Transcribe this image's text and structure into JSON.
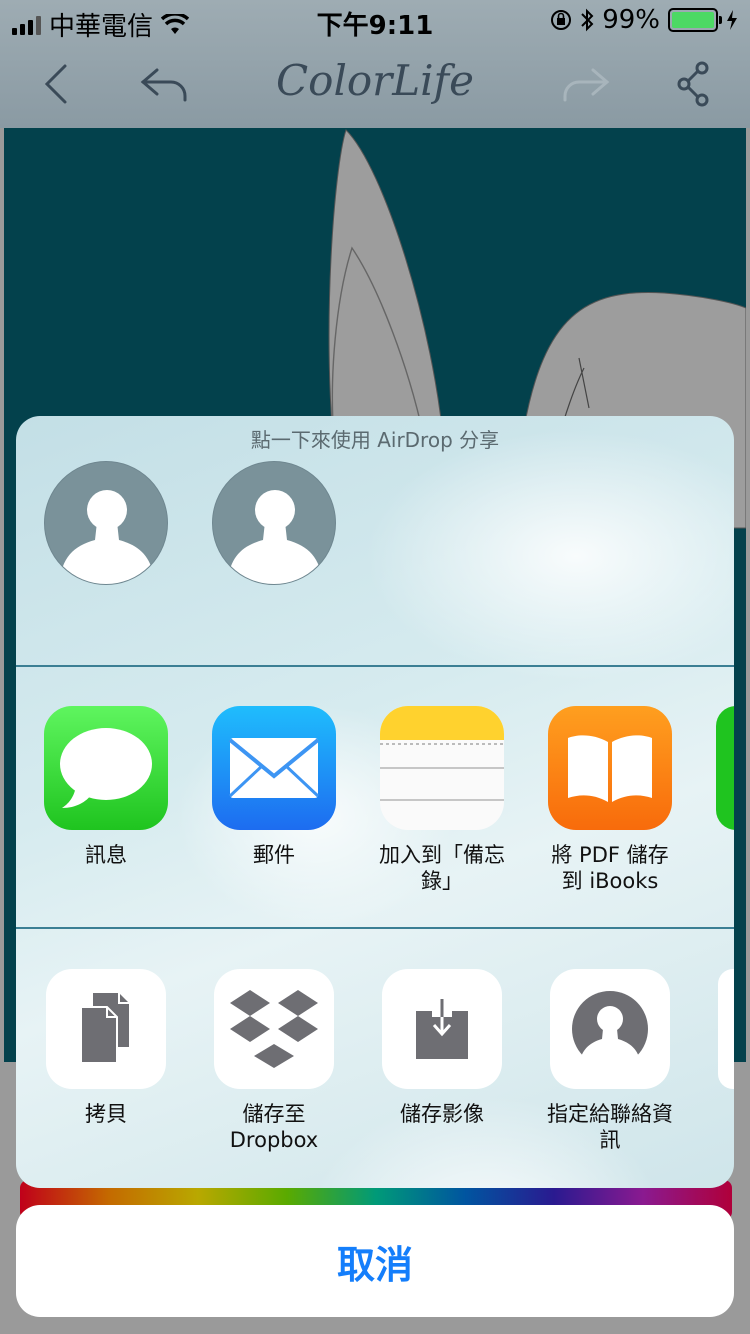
{
  "status_bar": {
    "carrier": "中華電信",
    "time": "下午9:11",
    "battery_percent": "99%",
    "battery_level": 0.99
  },
  "nav": {
    "title": "ColorLife",
    "icons": [
      "back-chevron-icon",
      "undo-icon",
      "redo-icon",
      "share-icon"
    ]
  },
  "share_sheet": {
    "airdrop_hint": "點一下來使用 AirDrop 分享",
    "apps": [
      {
        "label": "訊息",
        "icon": "messages-icon",
        "color": "#34c84a"
      },
      {
        "label": "郵件",
        "icon": "mail-icon",
        "color": "#1d8bf7"
      },
      {
        "label": "加入到「備忘錄」",
        "icon": "notes-icon",
        "color": "#ffd93b"
      },
      {
        "label": "將 PDF 儲存到 iBooks",
        "icon": "ibooks-icon",
        "color": "#fb7f0f"
      }
    ],
    "actions": [
      {
        "label": "拷貝",
        "icon": "copy-icon"
      },
      {
        "label": "儲存至 Dropbox",
        "icon": "dropbox-icon"
      },
      {
        "label": "儲存影像",
        "icon": "save-image-icon"
      },
      {
        "label": "指定給聯絡資訊",
        "icon": "assign-contact-icon"
      }
    ],
    "cancel_label": "取消"
  },
  "colors": {
    "canvas_bg": "#03414c",
    "accent_blue": "#147efb"
  }
}
